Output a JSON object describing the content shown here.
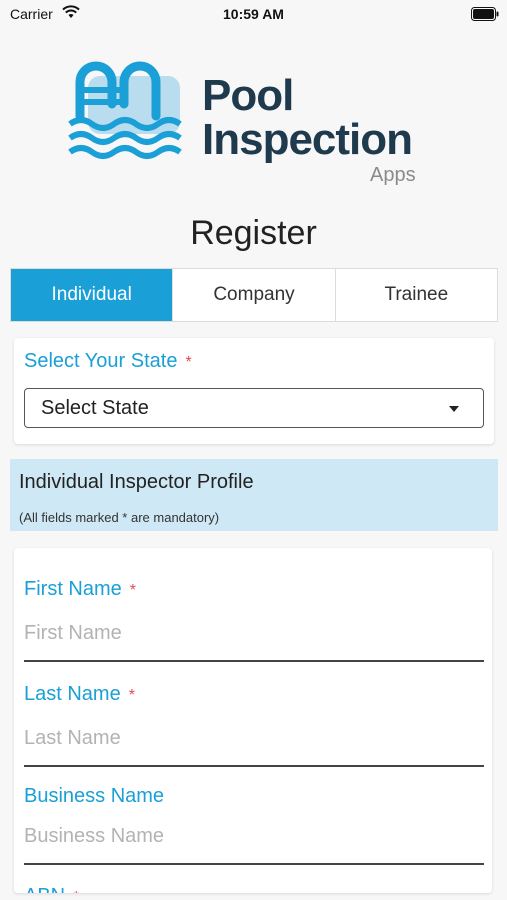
{
  "status_bar": {
    "carrier": "Carrier",
    "time": "10:59 AM",
    "wifi_icon": "wifi-icon",
    "battery_icon": "battery-icon"
  },
  "logo": {
    "title_line1": "Pool",
    "title_line2": "Inspection",
    "subtitle": "Apps",
    "icon": "pool-ladder-icon",
    "colors": {
      "brand_blue": "#1a9fd6",
      "brand_navy": "#1f3a4d"
    }
  },
  "page_title": "Register",
  "tabs": [
    {
      "label": "Individual",
      "active": true
    },
    {
      "label": "Company",
      "active": false
    },
    {
      "label": "Trainee",
      "active": false
    }
  ],
  "state": {
    "label": "Select Your State",
    "required_marker": "*",
    "selected_value": "Select State"
  },
  "profile": {
    "title": "Individual Inspector Profile",
    "note": "(All fields marked * are mandatory)"
  },
  "form": {
    "first_name": {
      "label": "First Name",
      "required_marker": "*",
      "placeholder": "First Name"
    },
    "last_name": {
      "label": "Last Name",
      "required_marker": "*",
      "placeholder": "Last Name"
    },
    "business_name": {
      "label": "Business Name",
      "placeholder": "Business Name"
    },
    "abn": {
      "label": "ABN",
      "required_marker": "*"
    }
  },
  "colors": {
    "accent": "#1a9fd6",
    "required": "#e24b4b",
    "banner": "#cfe8f5"
  }
}
